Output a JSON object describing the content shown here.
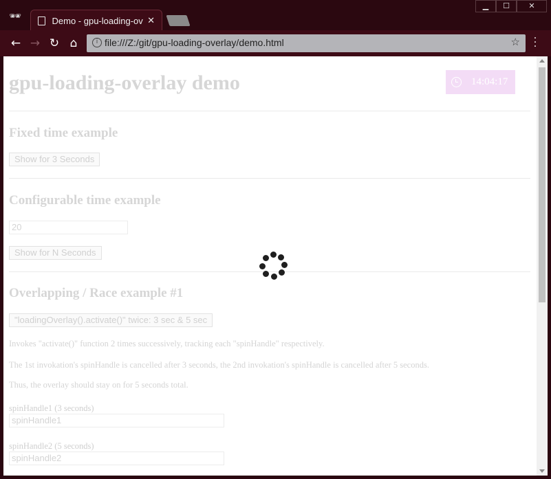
{
  "browser": {
    "tab_title": "Demo - gpu-loading-ove",
    "url": "file:///Z:/git/gpu-loading-overlay/demo.html",
    "controls": {
      "minimize": "▁",
      "maximize": "☐",
      "close": "✕"
    }
  },
  "page": {
    "title": "gpu-loading-overlay demo",
    "clock_time": "14:04:17",
    "fixed": {
      "heading": "Fixed time example",
      "button": "Show for 3 Seconds"
    },
    "configurable": {
      "heading": "Configurable time example",
      "input_value": "20",
      "button": "Show for N Seconds"
    },
    "race": {
      "heading": "Overlapping / Race example #1",
      "button": "\"loadingOverlay().activate()\" twice: 3 sec & 5 sec",
      "para1": "Invokes \"activate()\" function 2 times successively, tracking each \"spinHandle\" respectively.",
      "para2": "The 1st invokation's spinHandle is cancelled after 3 seconds, the 2nd invokation's spinHandle is cancelled after 5 seconds.",
      "para3": "Thus, the overlay should stay on for 5 seconds total.",
      "handle1_label": "spinHandle1 (3 seconds)",
      "handle1_placeholder": "spinHandle1",
      "handle2_label": "spinHandle2 (5 seconds)",
      "handle2_placeholder": "spinHandle2"
    }
  },
  "colors": {
    "clock_bg": "#f3dcf6",
    "spinner": "#1f1f1f",
    "chrome": "#3d0b16"
  }
}
